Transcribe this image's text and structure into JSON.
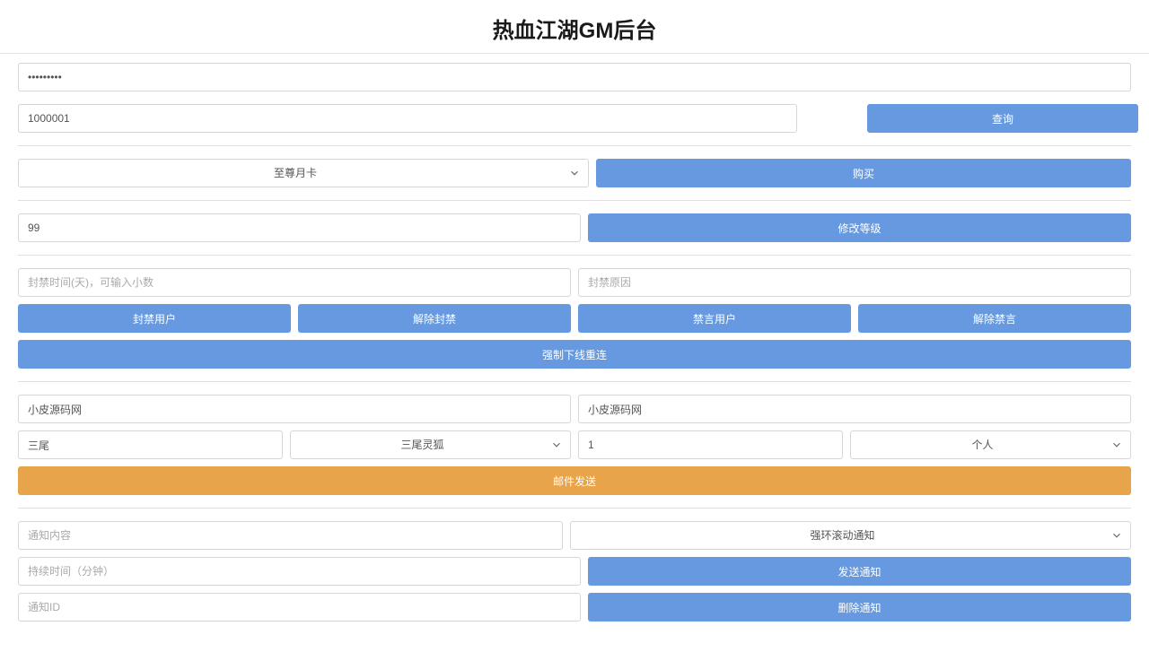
{
  "title": "热血江湖GM后台",
  "section_password": {
    "value": "•••••••••"
  },
  "section_query": {
    "id_value": "1000001",
    "query_button": "查询"
  },
  "section_card": {
    "selected": "至尊月卡",
    "buy_button": "购买"
  },
  "section_level": {
    "value": "99",
    "modify_button": "修改等级"
  },
  "section_ban": {
    "time_placeholder": "封禁时间(天)，可输入小数",
    "reason_placeholder": "封禁原因",
    "ban_user": "封禁用户",
    "unban": "解除封禁",
    "mute_user": "禁言用户",
    "unmute": "解除禁言",
    "force_offline": "强制下线重连"
  },
  "section_mail": {
    "from_value": "小皮源码网",
    "to_value": "小皮源码网",
    "item_text": "三尾",
    "item_select": "三尾灵狐",
    "count_value": "1",
    "scope_select": "个人",
    "send_button": "邮件发送"
  },
  "section_notify": {
    "content_placeholder": "通知内容",
    "type_select": "强环滚动通知",
    "duration_placeholder": "持续时间（分钟）",
    "send_button": "发送通知",
    "id_placeholder": "通知ID",
    "delete_button": "删除通知"
  }
}
